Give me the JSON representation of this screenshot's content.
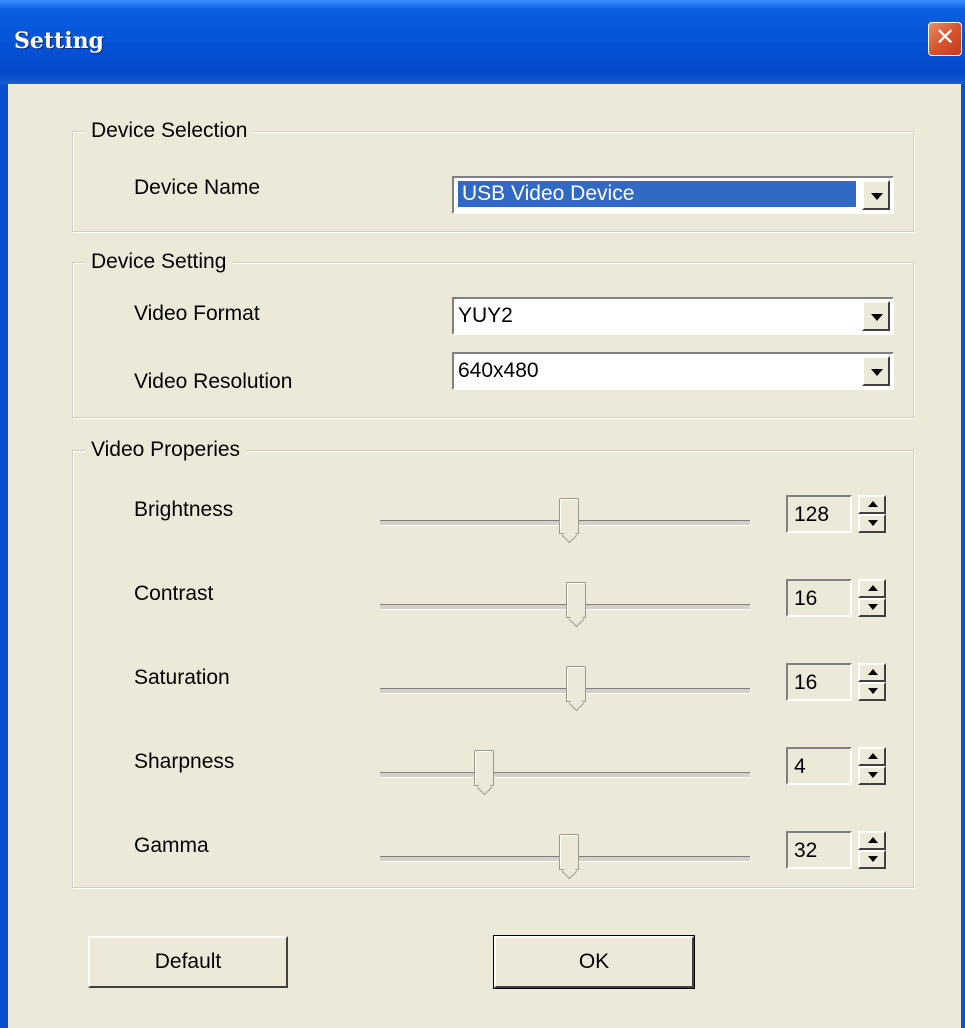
{
  "window": {
    "title": "Setting",
    "close_label": "✕"
  },
  "device_selection": {
    "title": "Device Selection",
    "device_name_label": "Device Name",
    "device_name_value": "USB Video Device"
  },
  "device_setting": {
    "title": "Device Setting",
    "video_format_label": "Video Format",
    "video_format_value": "YUY2",
    "video_resolution_label": "Video Resolution",
    "video_resolution_value": "640x480"
  },
  "video_properties": {
    "title": "Video Properies",
    "items": [
      {
        "label": "Brightness",
        "value": "128",
        "slider_fraction": 0.51
      },
      {
        "label": "Contrast",
        "value": "16",
        "slider_fraction": 0.53
      },
      {
        "label": "Saturation",
        "value": "16",
        "slider_fraction": 0.53
      },
      {
        "label": "Sharpness",
        "value": "4",
        "slider_fraction": 0.28
      },
      {
        "label": "Gamma",
        "value": "32",
        "slider_fraction": 0.51
      }
    ]
  },
  "buttons": {
    "default_label": "Default",
    "ok_label": "OK"
  },
  "colors": {
    "title_bar": "#0653D7",
    "dialog_bg": "#ECE9D8",
    "selection": "#316AC5",
    "close_button": "#D9532E"
  }
}
